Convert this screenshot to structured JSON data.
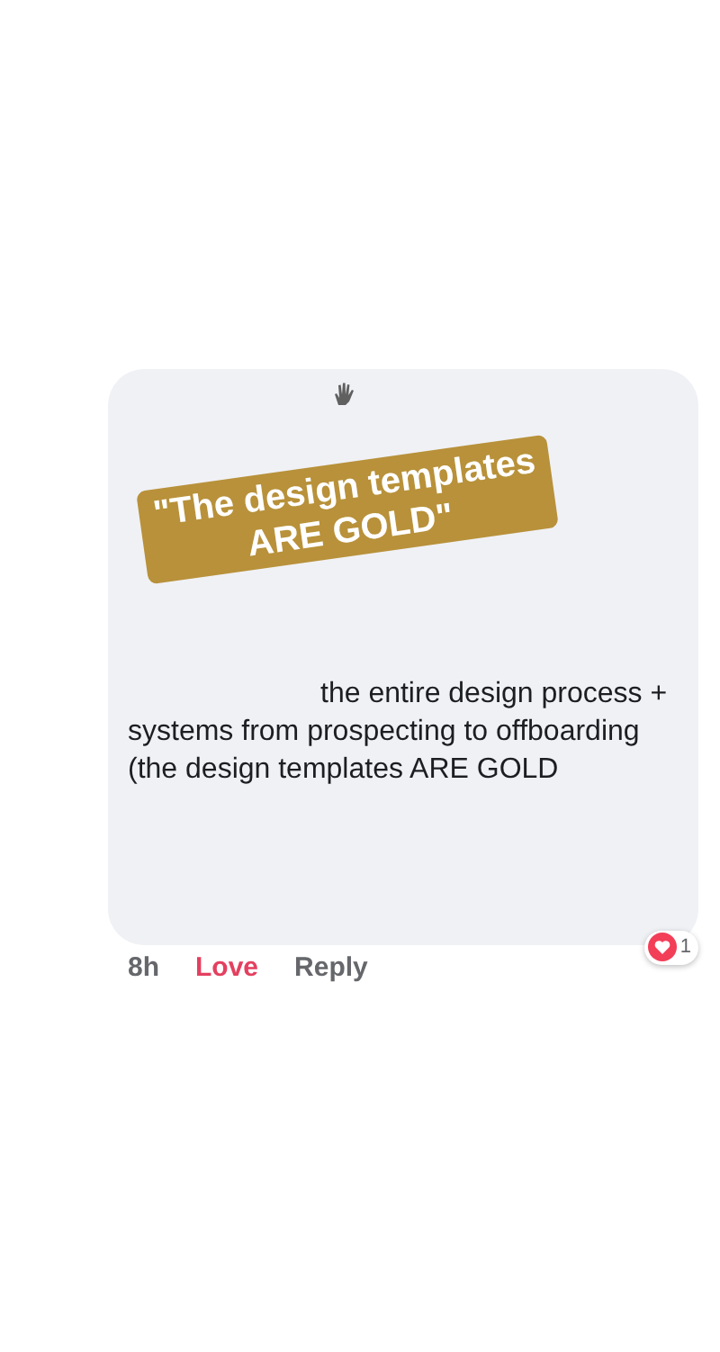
{
  "sticker": {
    "text": "\"The design templates\nARE GOLD\""
  },
  "comment": {
    "text": "the entire design process +\nsystems from prospecting to offboarding\n(the design templates ARE GOLD"
  },
  "actions": [
    {
      "kind": "time",
      "label": "8h"
    },
    {
      "kind": "reaction",
      "label": "Love",
      "selected": true
    },
    {
      "kind": "reply",
      "label": "Reply"
    }
  ],
  "reactions": {
    "count": "1"
  }
}
